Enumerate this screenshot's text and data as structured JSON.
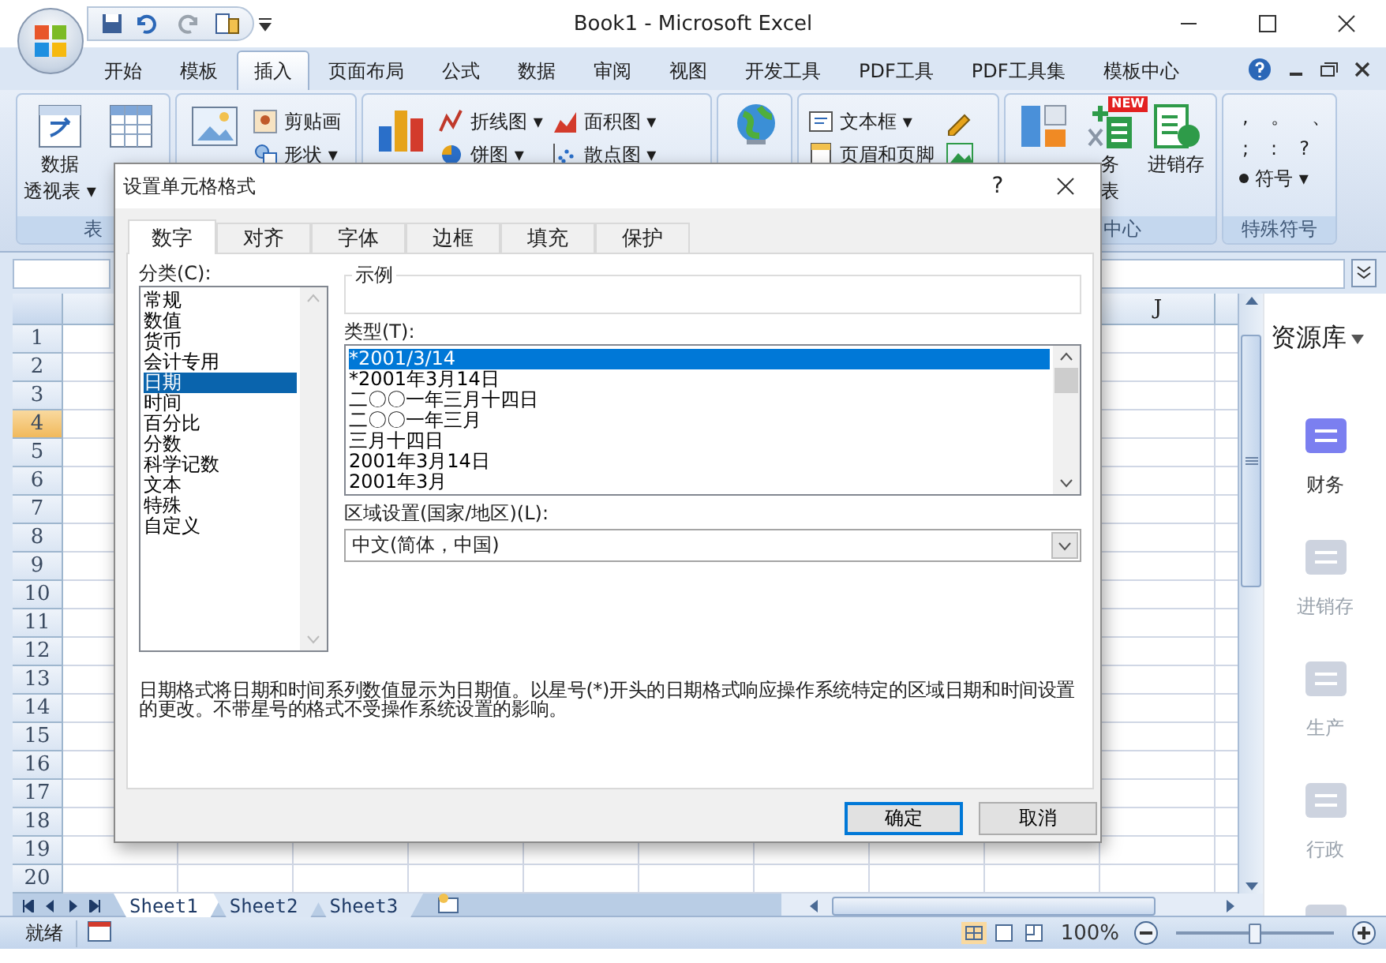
{
  "window": {
    "title": "Book1 - Microsoft Excel"
  },
  "ribbon_tabs": [
    {
      "label": "开始",
      "selected": false
    },
    {
      "label": "模板",
      "selected": false
    },
    {
      "label": "插入",
      "selected": true
    },
    {
      "label": "页面布局",
      "selected": false
    },
    {
      "label": "公式",
      "selected": false
    },
    {
      "label": "数据",
      "selected": false
    },
    {
      "label": "审阅",
      "selected": false
    },
    {
      "label": "视图",
      "selected": false
    },
    {
      "label": "开发工具",
      "selected": false
    },
    {
      "label": "PDF工具",
      "selected": false
    },
    {
      "label": "PDF工具集",
      "selected": false
    },
    {
      "label": "模板中心",
      "selected": false
    }
  ],
  "ribbon_groups": [
    {
      "label": "表",
      "items": [
        {
          "kind": "large",
          "lines": [
            "数据",
            "透视表 ▾"
          ]
        },
        {
          "kind": "large"
        }
      ]
    },
    {
      "items": [
        {
          "kind": "large"
        },
        {
          "kind": "stack",
          "entries": [
            "剪贴画",
            "形状 ▾"
          ]
        }
      ]
    },
    {
      "items": [
        {
          "kind": "large"
        },
        {
          "kind": "stack",
          "entries": [
            "折线图 ▾",
            "饼图 ▾"
          ]
        },
        {
          "kind": "stack",
          "entries": [
            "面积图 ▾",
            "散点图 ▾"
          ]
        }
      ]
    },
    {
      "items": [
        {
          "kind": "large"
        }
      ]
    },
    {
      "items": [
        {
          "kind": "stack",
          "entries": [
            "文本框 ▾",
            "页眉和页脚"
          ]
        },
        {
          "kind": "icons"
        }
      ]
    },
    {
      "label": "中心",
      "items": [
        {
          "kind": "large"
        },
        {
          "kind": "large",
          "badge": "NEW",
          "lines": [
            "务",
            "表"
          ]
        },
        {
          "kind": "large",
          "lines": [
            "进销存"
          ]
        }
      ]
    },
    {
      "label": "特殊符号",
      "items": [
        {
          "kind": "symbols",
          "rows": [
            [
              ",",
              "。",
              "、"
            ],
            [
              ";",
              ":",
              "?"
            ]
          ],
          "menu": "符号 ▾"
        }
      ]
    }
  ],
  "sheet": {
    "columns": [
      {
        "label": "J"
      }
    ],
    "rows": [
      {
        "label": "1",
        "selected": false
      },
      {
        "label": "2",
        "selected": false
      },
      {
        "label": "3",
        "selected": false
      },
      {
        "label": "4",
        "selected": true
      },
      {
        "label": "5",
        "selected": false
      },
      {
        "label": "6",
        "selected": false
      },
      {
        "label": "7",
        "selected": false
      },
      {
        "label": "8",
        "selected": false
      },
      {
        "label": "9",
        "selected": false
      },
      {
        "label": "10",
        "selected": false
      },
      {
        "label": "11",
        "selected": false
      },
      {
        "label": "12",
        "selected": false
      },
      {
        "label": "13",
        "selected": false
      },
      {
        "label": "14",
        "selected": false
      },
      {
        "label": "15",
        "selected": false
      },
      {
        "label": "16",
        "selected": false
      },
      {
        "label": "17",
        "selected": false
      },
      {
        "label": "18",
        "selected": false
      },
      {
        "label": "19",
        "selected": false
      },
      {
        "label": "20",
        "selected": false
      }
    ]
  },
  "side_panel": {
    "title": "资源库",
    "items": [
      {
        "label": "财务",
        "active": true
      },
      {
        "label": "进销存",
        "active": false
      },
      {
        "label": "生产",
        "active": false
      },
      {
        "label": "行政",
        "active": false
      },
      {
        "active": false
      }
    ]
  },
  "sheet_tabs": [
    {
      "label": "Sheet1",
      "selected": true
    },
    {
      "label": "Sheet2",
      "selected": false
    },
    {
      "label": "Sheet3",
      "selected": false
    }
  ],
  "status_bar": {
    "text": "就绪",
    "zoom": "100%",
    "zoom_slider": {
      "level": 0.5
    }
  },
  "dialog": {
    "title": "设置单元格格式",
    "help": "?",
    "tabs": [
      {
        "label": "数字",
        "selected": true
      },
      {
        "label": "对齐",
        "selected": false
      },
      {
        "label": "字体",
        "selected": false
      },
      {
        "label": "边框",
        "selected": false
      },
      {
        "label": "填充",
        "selected": false
      },
      {
        "label": "保护",
        "selected": false
      }
    ],
    "category_label": "分类(C):",
    "categories": [
      {
        "label": "常规",
        "selected": false
      },
      {
        "label": "数值",
        "selected": false
      },
      {
        "label": "货币",
        "selected": false
      },
      {
        "label": "会计专用",
        "selected": false
      },
      {
        "label": "日期",
        "selected": true
      },
      {
        "label": "时间",
        "selected": false
      },
      {
        "label": "百分比",
        "selected": false
      },
      {
        "label": "分数",
        "selected": false
      },
      {
        "label": "科学记数",
        "selected": false
      },
      {
        "label": "文本",
        "selected": false
      },
      {
        "label": "特殊",
        "selected": false
      },
      {
        "label": "自定义",
        "selected": false
      }
    ],
    "sample_label": "示例",
    "type_label": "类型(T):",
    "types": [
      {
        "label": "*2001/3/14",
        "selected": true
      },
      {
        "label": "*2001年3月14日",
        "selected": false
      },
      {
        "label": "二〇〇一年三月十四日",
        "selected": false
      },
      {
        "label": "二〇〇一年三月",
        "selected": false
      },
      {
        "label": "三月十四日",
        "selected": false
      },
      {
        "label": "2001年3月14日",
        "selected": false
      },
      {
        "label": "2001年3月",
        "selected": false
      }
    ],
    "locale_label": "区域设置(国家/地区)(L):",
    "locale": "中文(简体，中国)",
    "description": "日期格式将日期和时间系列数值显示为日期值。以星号(*)开头的日期格式响应操作系统特定的区域日期和时间设置的更改。不带星号的格式不受操作系统设置的影响。",
    "buttons": [
      {
        "label": "确定",
        "default": true
      },
      {
        "label": "取消",
        "default": false
      }
    ]
  }
}
